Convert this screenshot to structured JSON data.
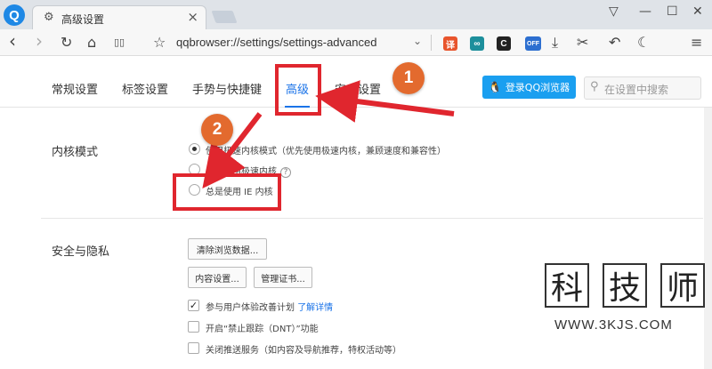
{
  "tabstrip": {
    "logo": "Q",
    "tab_title": "高级设置",
    "tab_close": "×",
    "window_controls": [
      "▽",
      "—",
      "☐",
      "✕"
    ]
  },
  "toolbar": {
    "url": "qqbrowser://settings/settings-advanced",
    "url_dropdown": "⌄",
    "nav_icons": {
      "back": "‹",
      "forward": "›",
      "reload": "↻",
      "home": "⌂",
      "reader": "▯▯",
      "star": "☆"
    },
    "extensions": [
      {
        "name": "translate",
        "label": "译",
        "color": "#e8542c"
      },
      {
        "name": "arduino",
        "label": "∞",
        "color": "#1d8f9c"
      },
      {
        "name": "c-ext",
        "label": "C",
        "color": "#222222"
      },
      {
        "name": "off-ext",
        "label": "OFF",
        "color": "#2d6fd0"
      }
    ],
    "right_icons": [
      "⤓",
      "✂",
      "↶",
      "☾",
      "≡"
    ]
  },
  "nav": {
    "tabs": [
      "常规设置",
      "标签设置",
      "手势与快捷键",
      "高级",
      "安全设置"
    ],
    "active_index": 3,
    "login_label": "登录QQ浏览器",
    "search_placeholder": "在设置中搜索",
    "accent": "#1a73e8"
  },
  "kernel": {
    "label": "内核模式",
    "options": [
      {
        "text": "使用极速内核模式（优先使用极速内核，兼顾速度和兼容性）",
        "selected": true
      },
      {
        "text": "总是使用极速内核",
        "selected": false,
        "help": "?"
      },
      {
        "text": "总是使用 IE 内核",
        "selected": false
      }
    ]
  },
  "privacy": {
    "label": "安全与隐私",
    "buttons": [
      "清除浏览数据...",
      "内容设置...",
      "管理证书..."
    ],
    "checkboxes": [
      {
        "text": "参与用户体验改善计划",
        "link": "了解详情",
        "checked": true
      },
      {
        "text": "开启“禁止跟踪（DNT）”功能",
        "checked": false
      },
      {
        "text": "关闭推送服务（如内容及导航推荐，特权活动等）",
        "checked": false
      }
    ]
  },
  "annotations": {
    "badge1": "1",
    "badge2": "2",
    "color": "#e0262e"
  },
  "watermark": {
    "chars": [
      "科",
      "技",
      "师"
    ],
    "url": "WWW.3KJS.COM"
  }
}
